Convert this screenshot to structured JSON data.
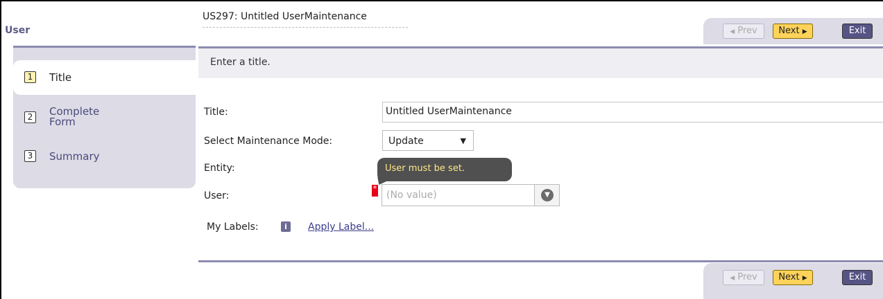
{
  "sidebar": {
    "title": "User",
    "steps": [
      {
        "number": "1",
        "label": "Title",
        "active": true
      },
      {
        "number": "2",
        "label": "Complete Form",
        "active": false
      },
      {
        "number": "3",
        "label": "Summary",
        "active": false
      }
    ]
  },
  "header": {
    "title": "US297: Untitled UserMaintenance"
  },
  "toolbar": {
    "prev_label": "Prev",
    "next_label": "Next",
    "exit_label": "Exit"
  },
  "instruction": "Enter a title.",
  "form": {
    "title_label": "Title:",
    "title_value": "Untitled UserMaintenance",
    "mode_label": "Select Maintenance Mode:",
    "mode_value": "Update",
    "entity_label": "Entity:",
    "user_label": "User:",
    "user_placeholder": "(No value)",
    "user_error": "User must be set.",
    "required_marker": "*",
    "my_labels": "My Labels:",
    "apply_label": "Apply Label..."
  },
  "colors": {
    "accent": "#8c8bb0",
    "next_button": "#fdd35a",
    "exit_button": "#565385",
    "error_marker": "#e8001c",
    "tooltip_text": "#ffe88a"
  },
  "icons": {
    "prev": "chevron-left-icon",
    "next": "triangle-right-icon",
    "dropdown": "chevron-down-icon",
    "info": "info-icon"
  }
}
